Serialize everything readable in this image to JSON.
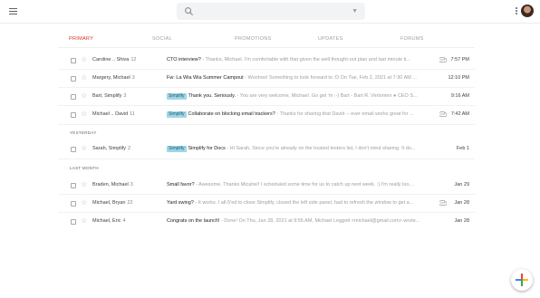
{
  "topbar": {
    "search_icon": "search-icon",
    "dropdown_icon": "chevron-down-icon",
    "menu_icon": "hamburger-icon"
  },
  "tabs": [
    "PRIMARY",
    "SOCIAL",
    "PROMOTIONS",
    "UPDATES",
    "FORUMS"
  ],
  "colors": {
    "active_tab": "#d93025",
    "label_bg": "#9fd6e6",
    "fab_blue": "#4285f4",
    "fab_red": "#ea4335",
    "fab_yellow": "#fbbc05",
    "fab_green": "#34a853"
  },
  "rows_top": [
    {
      "sender": "Caroline .. Shiva",
      "count": "12",
      "label": "",
      "subject": "CTO interview?",
      "snippet": " - Thanks, Michael. I'm comfortable with that given the well thought-out plan and last minute ti...",
      "attachment": true,
      "date": "7:57 PM"
    },
    {
      "sender": "Margery, Michael",
      "count": "3",
      "label": "",
      "subject": "Fw: La Wia Wia Summer Campout",
      "snippet": " - Woohoo! Something to look forward to :D On Tue, Feb 2, 2021 at 7:30 AM ...",
      "attachment": false,
      "date": "12:10 PM"
    },
    {
      "sender": "Bart, Simplify",
      "count": "3",
      "label": "Simplify",
      "subject": "Thank you. Seriously.",
      "snippet": " - You are very welcome, Michael. Go get 'm :-) Bart - Bart R. Verlomen ● CEO S...",
      "attachment": false,
      "date": "9:16 AM"
    },
    {
      "sender": "Michael .. David",
      "count": "11",
      "label": "Simplify",
      "subject": "Collaborate on blocking email trackers?",
      "snippet": " - Thanks for sharing that David -- over email works great for ...",
      "attachment": true,
      "date": "7:42 AM"
    }
  ],
  "section_yesterday": "YESTERDAY",
  "rows_yesterday": [
    {
      "sender": "Sarah, Simplify",
      "count": "2",
      "label": "Simplify",
      "subject": "Simplify for Docs",
      "snippet": " - Hi Sarah, Since you're already on the trusted testers list, I don't mind sharing. It do...",
      "attachment": false,
      "date": "Feb 1"
    }
  ],
  "section_last_month": "LAST MONTH",
  "rows_last_month": [
    {
      "sender": "Braden, Michael",
      "count": "3",
      "label": "",
      "subject": "Small favor?",
      "snippet": " - Awesome. Thanks Micahel! I scheduled some time for us to catch up next week. :) I'm really loo...",
      "attachment": false,
      "date": "Jan 29"
    },
    {
      "sender": "Michael, Bryan",
      "count": "22",
      "label": "",
      "subject": "Yard swing?",
      "snippet": " - It works. I all-5'ed to close Simplify, closed the left side panel, had to refresh the window to get a...",
      "attachment": true,
      "date": "Jan 28"
    },
    {
      "sender": "Michael, Eric",
      "count": "4",
      "label": "",
      "subject": "Congrats on the launch!",
      "snippet": " - Done! On Thu, Jan 28, 2021 at 9:55 AM, Michael Leggett <michael@gmail.com> wrote...",
      "attachment": false,
      "date": "Jan 28"
    }
  ]
}
